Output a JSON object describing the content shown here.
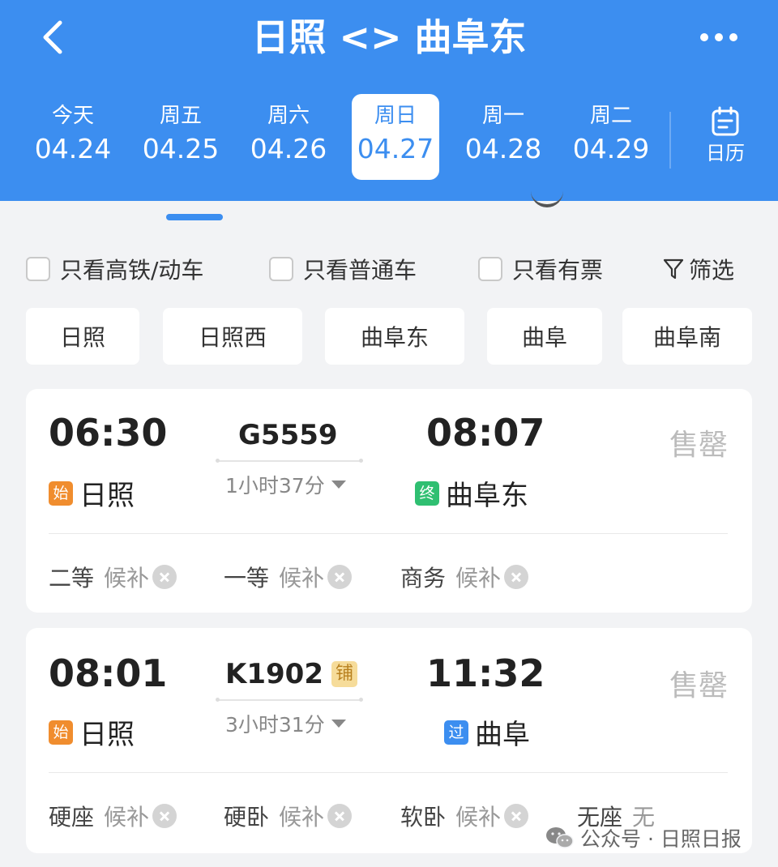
{
  "header": {
    "title": "日照 <> 曲阜东",
    "back_icon": "chevron-left-icon",
    "more_icon": "more-horizontal-icon",
    "background_color": "#3c8ef0",
    "dates": [
      {
        "dow": "今天",
        "date": "04.24",
        "selected": false
      },
      {
        "dow": "周五",
        "date": "04.25",
        "selected": false
      },
      {
        "dow": "周六",
        "date": "04.26",
        "selected": false
      },
      {
        "dow": "周日",
        "date": "04.27",
        "selected": true
      },
      {
        "dow": "周一",
        "date": "04.28",
        "selected": false
      },
      {
        "dow": "周二",
        "date": "04.29",
        "selected": false
      }
    ],
    "calendar_label": "日历",
    "calendar_icon": "calendar-icon"
  },
  "filters": {
    "items": [
      {
        "label": "只看高铁/动车",
        "checked": false
      },
      {
        "label": "只看普通车",
        "checked": false
      },
      {
        "label": "只看有票",
        "checked": false
      }
    ],
    "filter_label": "筛选",
    "filter_icon": "funnel-icon"
  },
  "stations": [
    "日照",
    "日照西",
    "曲阜东",
    "曲阜",
    "曲阜南"
  ],
  "trains": [
    {
      "dep_time": "06:30",
      "train_no": "G5559",
      "arr_time": "08:07",
      "duration": "1小时37分",
      "from_badge": "始",
      "from_station": "日照",
      "to_badge": "终",
      "to_station": "曲阜东",
      "status": "售罄",
      "seats": [
        {
          "class": "二等",
          "availability": "候补"
        },
        {
          "class": "一等",
          "availability": "候补"
        },
        {
          "class": "商务",
          "availability": "候补"
        }
      ]
    },
    {
      "dep_time": "08:01",
      "train_no": "K1902",
      "sleeper_badge": "铺",
      "arr_time": "11:32",
      "duration": "3小时31分",
      "from_badge": "始",
      "from_station": "日照",
      "to_badge": "过",
      "to_station": "曲阜",
      "status": "售罄",
      "seats": [
        {
          "class": "硬座",
          "availability": "候补"
        },
        {
          "class": "硬卧",
          "availability": "候补"
        },
        {
          "class": "软卧",
          "availability": "候补"
        },
        {
          "class": "无座",
          "availability": "无"
        }
      ]
    }
  ],
  "badge_colors": {
    "start": "#f08d2e",
    "end": "#2fbf71",
    "pass": "#3c8ef0"
  },
  "watermark": {
    "text": "公众号 · 日照日报",
    "icon": "wechat-icon"
  }
}
